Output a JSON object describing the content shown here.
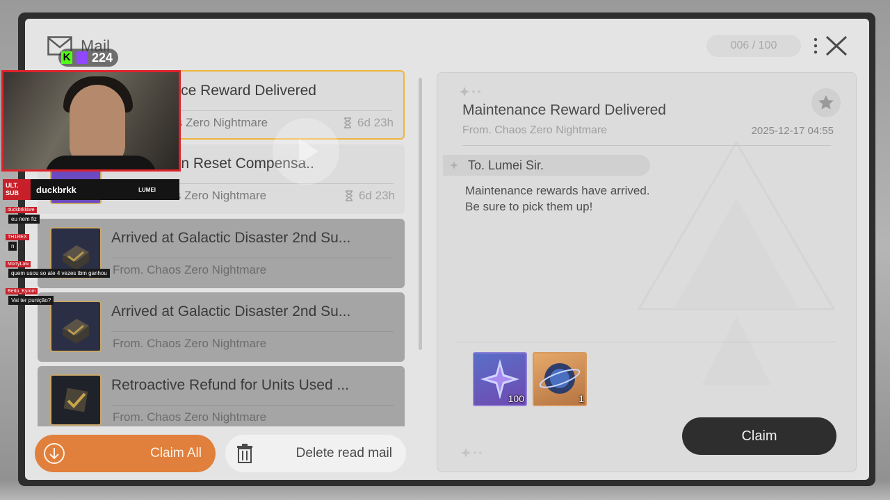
{
  "header": {
    "title": "Mail",
    "counter": "006 / 100"
  },
  "mail_list": [
    {
      "title": "Maintenance Reward Delivered",
      "from": "From. Chaos Zero Nightmare",
      "time": "6d 23h",
      "state": "selected"
    },
    {
      "title": "Progression Reset Compensa..",
      "from": "From. Chaos Zero Nightmare",
      "time": "6d 23h",
      "state": "unread"
    },
    {
      "title": "Arrived at Galactic Disaster 2nd Su...",
      "from": "From. Chaos Zero Nightmare",
      "time": "",
      "state": "read"
    },
    {
      "title": "Arrived at Galactic Disaster 2nd Su...",
      "from": "From. Chaos Zero Nightmare",
      "time": "",
      "state": "read"
    },
    {
      "title": "Retroactive Refund for Units Used ...",
      "from": "From. Chaos Zero Nightmare",
      "time": "",
      "state": "read"
    }
  ],
  "buttons": {
    "claim_all": "Claim All",
    "delete_read": "Delete read mail",
    "claim": "Claim"
  },
  "detail": {
    "title": "Maintenance Reward Delivered",
    "from": "From. Chaos Zero Nightmare",
    "date": "2025-12-17 04:55",
    "to": "To. Lumei Sir.",
    "body": [
      "Maintenance rewards have arrived.",
      "Be sure to pick them up!"
    ],
    "rewards": [
      {
        "icon": "crystal-shard-icon",
        "qty": "100"
      },
      {
        "icon": "orb-icon",
        "qty": "1"
      }
    ]
  },
  "stream_overlay": {
    "viewer_count": "224",
    "kick_badge": "K",
    "streamer_name": "duckbrkk",
    "ult_badge": "ULT. SUB",
    "sponsor": "LUMEI",
    "chat": [
      {
        "user": "duckbrkkiwe",
        "text": "eu nem fiz"
      },
      {
        "user": "TH1REX",
        "text": "n"
      },
      {
        "user": "MortyLaw",
        "text": "quem usou so ate 4 vezes tbm ganhou"
      },
      {
        "user": "Betto_Kyrom",
        "text": "Vai ter punição?"
      }
    ]
  },
  "colors": {
    "accent_orange": "#e0803c",
    "selected_border": "#f0b43c",
    "claim_dark": "#2e2e2e",
    "stream_red": "#e0222a"
  }
}
